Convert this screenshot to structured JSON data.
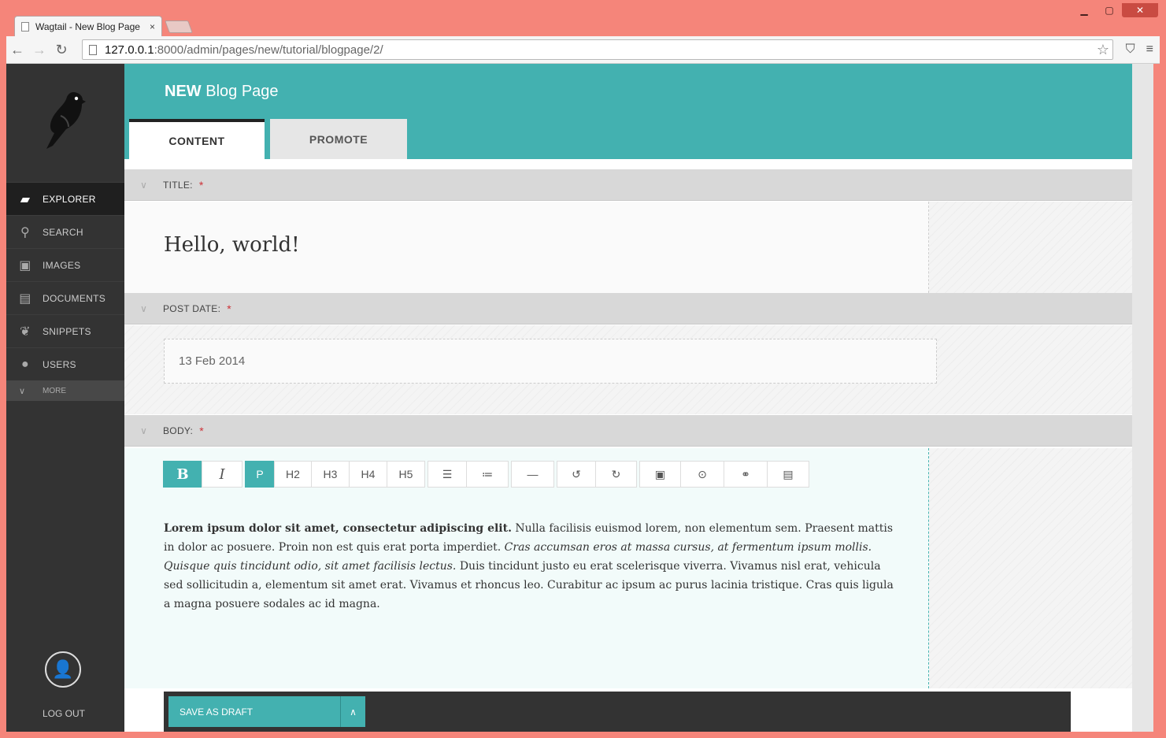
{
  "browser": {
    "tab_title": "Wagtail - New Blog Page",
    "tab_close": "×",
    "url_host": "127.0.0.1",
    "url_path": ":8000/admin/pages/new/tutorial/blogpage/2/"
  },
  "sidebar": {
    "items": [
      {
        "label": "EXPLORER",
        "icon": "folder-open-icon",
        "active": true
      },
      {
        "label": "SEARCH",
        "icon": "search-icon"
      },
      {
        "label": "IMAGES",
        "icon": "image-icon"
      },
      {
        "label": "DOCUMENTS",
        "icon": "document-icon"
      },
      {
        "label": "SNIPPETS",
        "icon": "snippet-icon"
      },
      {
        "label": "USERS",
        "icon": "user-icon"
      }
    ],
    "more_label": "MORE",
    "logout_label": "LOG OUT"
  },
  "header": {
    "title_strong": "NEW",
    "title_rest": "Blog Page",
    "tabs": [
      "CONTENT",
      "PROMOTE"
    ]
  },
  "fields": {
    "title_label": "TITLE:",
    "title_value": "Hello, world!",
    "date_label": "POST DATE:",
    "date_value": "13 Feb 2014",
    "body_label": "BODY:",
    "required_mark": "*"
  },
  "editor": {
    "bold": "B",
    "italic": "I",
    "headings": [
      "P",
      "H2",
      "H3",
      "H4",
      "H5"
    ],
    "hr": "—",
    "body": {
      "bold": "Lorem ipsum dolor sit amet, consectetur adipiscing elit.",
      "text1": " Nulla facilisis euismod lorem, non elementum sem. Praesent mattis in dolor ac posuere. Proin non est quis erat porta imperdiet. ",
      "italic": "Cras accumsan eros at massa cursus, at fermentum ipsum mollis. Quisque quis tincidunt odio, sit amet facilisis lectus.",
      "text2": " Duis tincidunt justo eu erat scelerisque viverra. Vivamus nisl erat, vehicula sed sollicitudin a, elementum sit amet erat. Vivamus et rhoncus leo. Curabitur ac ipsum ac purus lacinia tristique. Cras quis ligula a magna posuere sodales ac id magna."
    }
  },
  "footer": {
    "save_label": "SAVE AS DRAFT"
  },
  "colors": {
    "accent": "#43b1b0",
    "sidebar": "#333333",
    "required": "#cd3238"
  }
}
